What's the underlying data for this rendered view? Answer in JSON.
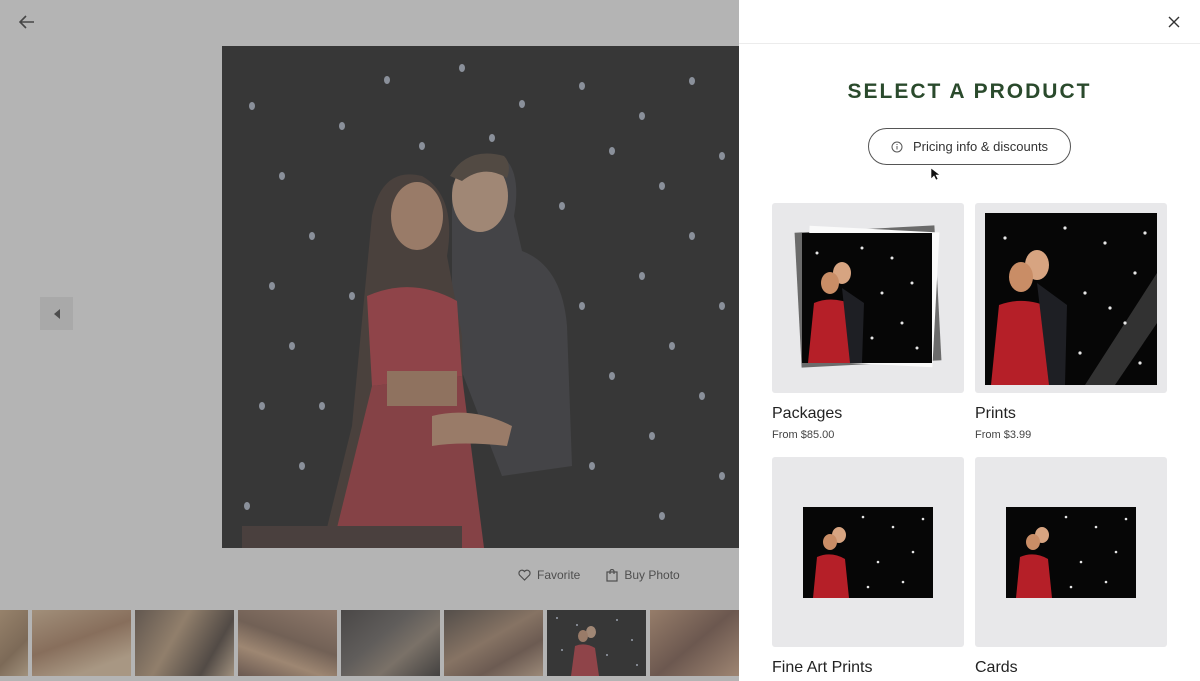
{
  "viewer": {
    "actions": {
      "favorite": "Favorite",
      "buy_photo": "Buy Photo"
    },
    "filmstrip_count": 8,
    "selected_thumb_index": 5
  },
  "drawer": {
    "title": "SELECT A PRODUCT",
    "pricing_button": "Pricing info & discounts",
    "products": [
      {
        "name": "Packages",
        "price": "From $85.00"
      },
      {
        "name": "Prints",
        "price": "From $3.99"
      },
      {
        "name": "Fine Art Prints",
        "price": ""
      },
      {
        "name": "Cards",
        "price": ""
      }
    ]
  },
  "colors": {
    "title_green": "#2a4a2c",
    "dim_overlay": "#696969",
    "dress_red": "#b51f28"
  },
  "icons": {
    "back": "arrow-left-icon",
    "close": "close-icon",
    "prev": "caret-left-icon",
    "favorite": "heart-icon",
    "buy": "bag-icon",
    "info": "info-circle-icon"
  }
}
